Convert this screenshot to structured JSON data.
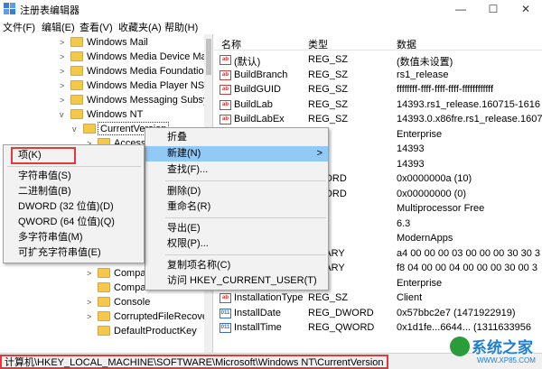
{
  "window": {
    "title": "注册表编辑器",
    "controls": {
      "minimize": "—",
      "maximize": "☐",
      "close": "✕"
    }
  },
  "menubar": [
    "文件(F)",
    "编辑(E)",
    "查看(V)",
    "收藏夹(A)",
    "帮助(H)"
  ],
  "tree": {
    "items": [
      {
        "label": "Windows Mail",
        "arrow": ">"
      },
      {
        "label": "Windows Media Device Ma",
        "arrow": ">"
      },
      {
        "label": "Windows Media Foundatior",
        "arrow": ">"
      },
      {
        "label": "Windows Media Player NSS",
        "arrow": ">"
      },
      {
        "label": "Windows Messaging Subsy",
        "arrow": ">"
      },
      {
        "label": "Windows NT",
        "arrow": "v"
      },
      {
        "label": "CurrentVersion",
        "arrow": "v"
      },
      {
        "label": "Accessi",
        "arrow": ">"
      },
      {
        "label": "Compa",
        "arrow": ">"
      },
      {
        "label": "Compa",
        "arrow": ""
      },
      {
        "label": "Console",
        "arrow": ">"
      },
      {
        "label": "CorruptedFileRecove",
        "arrow": ">"
      },
      {
        "label": "DefaultProductKey",
        "arrow": ""
      }
    ]
  },
  "list": {
    "headers": {
      "name": "名称",
      "type": "类型",
      "data": "数据"
    },
    "rows": [
      {
        "name": "(默认)",
        "type": "REG_SZ",
        "data": "(数值未设置)",
        "icon": "ab"
      },
      {
        "name": "BuildBranch",
        "type": "REG_SZ",
        "data": "rs1_release",
        "icon": "ab"
      },
      {
        "name": "BuildGUID",
        "type": "REG_SZ",
        "data": "ffffffff-ffff-ffff-ffff-ffffffffffff",
        "icon": "ab"
      },
      {
        "name": "BuildLab",
        "type": "REG_SZ",
        "data": "14393.rs1_release.160715-1616",
        "icon": "ab"
      },
      {
        "name": "BuildLabEx",
        "type": "REG_SZ",
        "data": "14393.0.x86fre.rs1_release.1607",
        "icon": "ab"
      },
      {
        "name": "",
        "type": "SZ",
        "data": "Enterprise",
        "icon": ""
      },
      {
        "name": "",
        "type": "SZ",
        "data": "14393",
        "icon": ""
      },
      {
        "name": "",
        "type": "SZ",
        "data": "14393",
        "icon": ""
      },
      {
        "name": "",
        "type": "DWORD",
        "data": "0x0000000a (10)",
        "icon": ""
      },
      {
        "name": "",
        "type": "DWORD",
        "data": "0x00000000 (0)",
        "icon": ""
      },
      {
        "name": "",
        "type": "SZ",
        "data": "Multiprocessor Free",
        "icon": ""
      },
      {
        "name": "",
        "type": "SZ",
        "data": "6.3",
        "icon": ""
      },
      {
        "name": "",
        "type": "SZ",
        "data": "ModernApps",
        "icon": ""
      },
      {
        "name": "",
        "type": "BINARY",
        "data": "a4 00 00 00 03 00 00 00 30 30 3",
        "icon": ""
      },
      {
        "name": "",
        "type": "BINARY",
        "data": "f8 04 00 00 04 00 00 00 30 00 3",
        "icon": ""
      },
      {
        "name": "",
        "type": "SZ",
        "data": "Enterprise",
        "icon": ""
      },
      {
        "name": "InstallationType",
        "type": "REG_SZ",
        "data": "Client",
        "icon": "ab"
      },
      {
        "name": "InstallDate",
        "type": "REG_DWORD",
        "data": "0x57bbc2e7 (1471922919)",
        "icon": "bin"
      },
      {
        "name": "InstallTime",
        "type": "REG_QWORD",
        "data": "0x1d1fe...6644... (1311633956",
        "icon": "bin"
      }
    ]
  },
  "context_menu_main": {
    "items": [
      "折叠",
      "新建(N)",
      "查找(F)...",
      "删除(D)",
      "重命名(R)",
      "导出(E)",
      "权限(P)...",
      "复制项名称(C)",
      "访问 HKEY_CURRENT_USER(T)"
    ],
    "submenu_arrow": ">"
  },
  "context_menu_new": {
    "items": [
      "项(K)",
      "字符串值(S)",
      "二进制值(B)",
      "DWORD (32 位值)(D)",
      "QWORD (64 位值)(Q)",
      "多字符串值(M)",
      "可扩充字符串值(E)"
    ]
  },
  "statusbar": {
    "path": "计算机\\HKEY_LOCAL_MACHINE\\SOFTWARE\\Microsoft\\Windows NT\\CurrentVersion"
  },
  "watermark": {
    "text": "系统之家",
    "url": "WWW.XP85.COM"
  },
  "colors": {
    "highlight": "#91c9f7",
    "annotation_red": "#e23a3a",
    "folder": "#f4c84b"
  }
}
